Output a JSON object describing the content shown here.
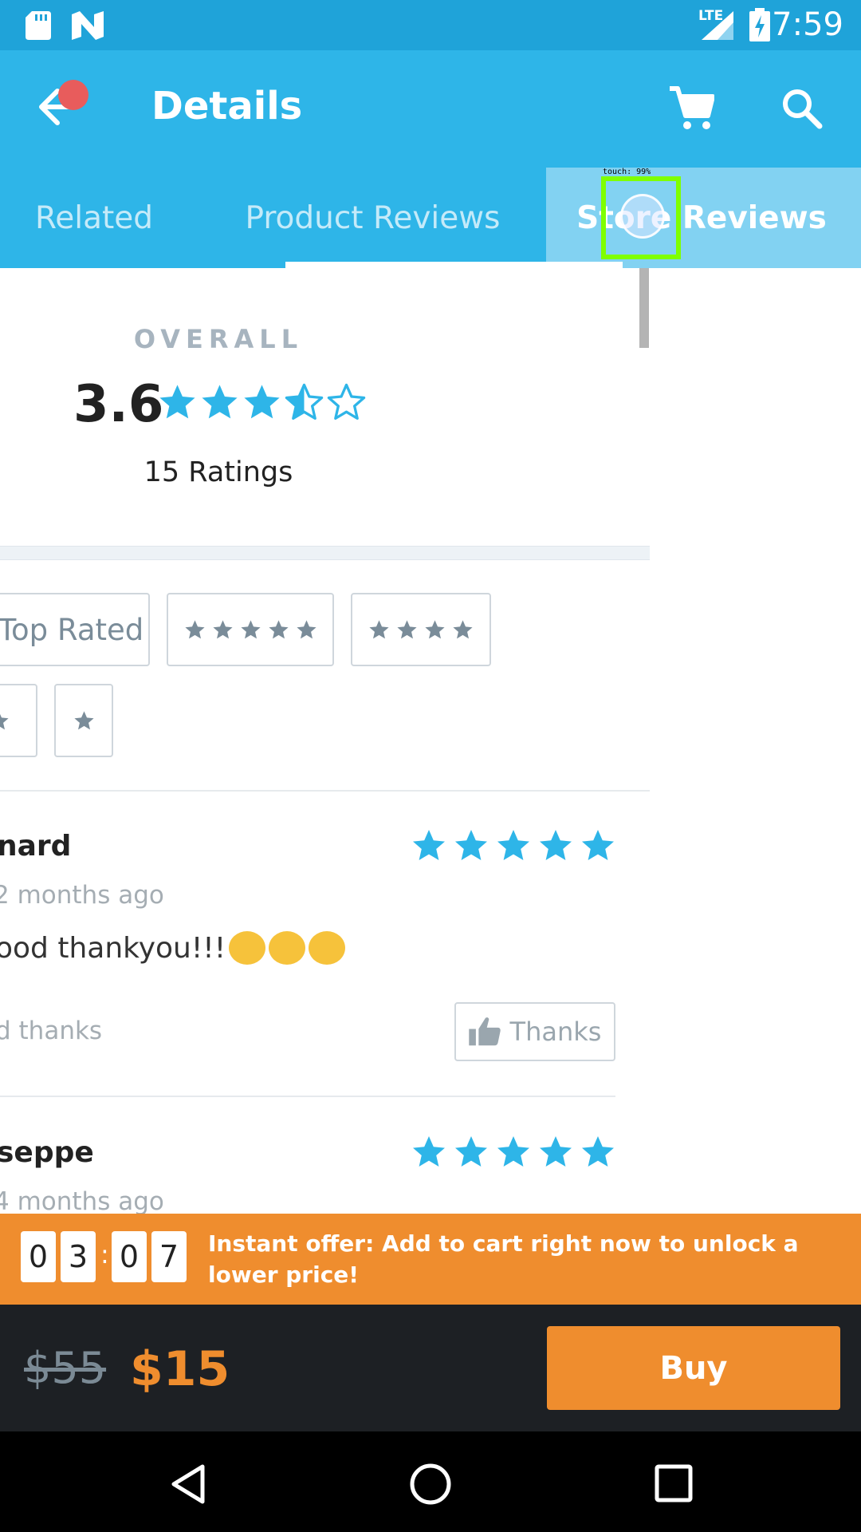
{
  "status_bar": {
    "time": "7:59",
    "network": "LTE"
  },
  "app_bar": {
    "title": "Details",
    "back_icon": "back-arrow-icon",
    "cart_icon": "cart-icon",
    "search_icon": "search-icon"
  },
  "tabs": [
    {
      "label": "Related",
      "active": false
    },
    {
      "label": "Product Reviews",
      "active": false
    },
    {
      "label": "Store Reviews",
      "active": true
    }
  ],
  "overall": {
    "label": "OVERALL",
    "score": "3.6",
    "stars": 3.5,
    "ratings": "15 Ratings"
  },
  "filters": {
    "top_rated": "Top Rated",
    "options": [
      "5 stars",
      "4 stars",
      "2 stars",
      "1 star"
    ]
  },
  "reviews": [
    {
      "name": "nard",
      "time": "2 months ago",
      "text": "ood thankyou!!!",
      "helpful": "d thanks",
      "thanks_button": "Thanks",
      "stars": 5
    },
    {
      "name": "seppe",
      "time": "4 months ago",
      "stars": 5
    }
  ],
  "offer": {
    "timer": [
      "0",
      "3",
      "0",
      "7"
    ],
    "separator": ":",
    "text": "Instant offer: Add to cart right now to unlock a lower price!"
  },
  "buy_bar": {
    "old_price": "$55",
    "new_price": "$15",
    "buy_label": "Buy"
  },
  "touch_overlay": {
    "label": "touch: 99%"
  },
  "colors": {
    "primary": "#2eb5e8",
    "status": "#1fa3d9",
    "accent": "#ef8d2e",
    "star": "#2eb5e8",
    "dark": "#1d2024"
  }
}
